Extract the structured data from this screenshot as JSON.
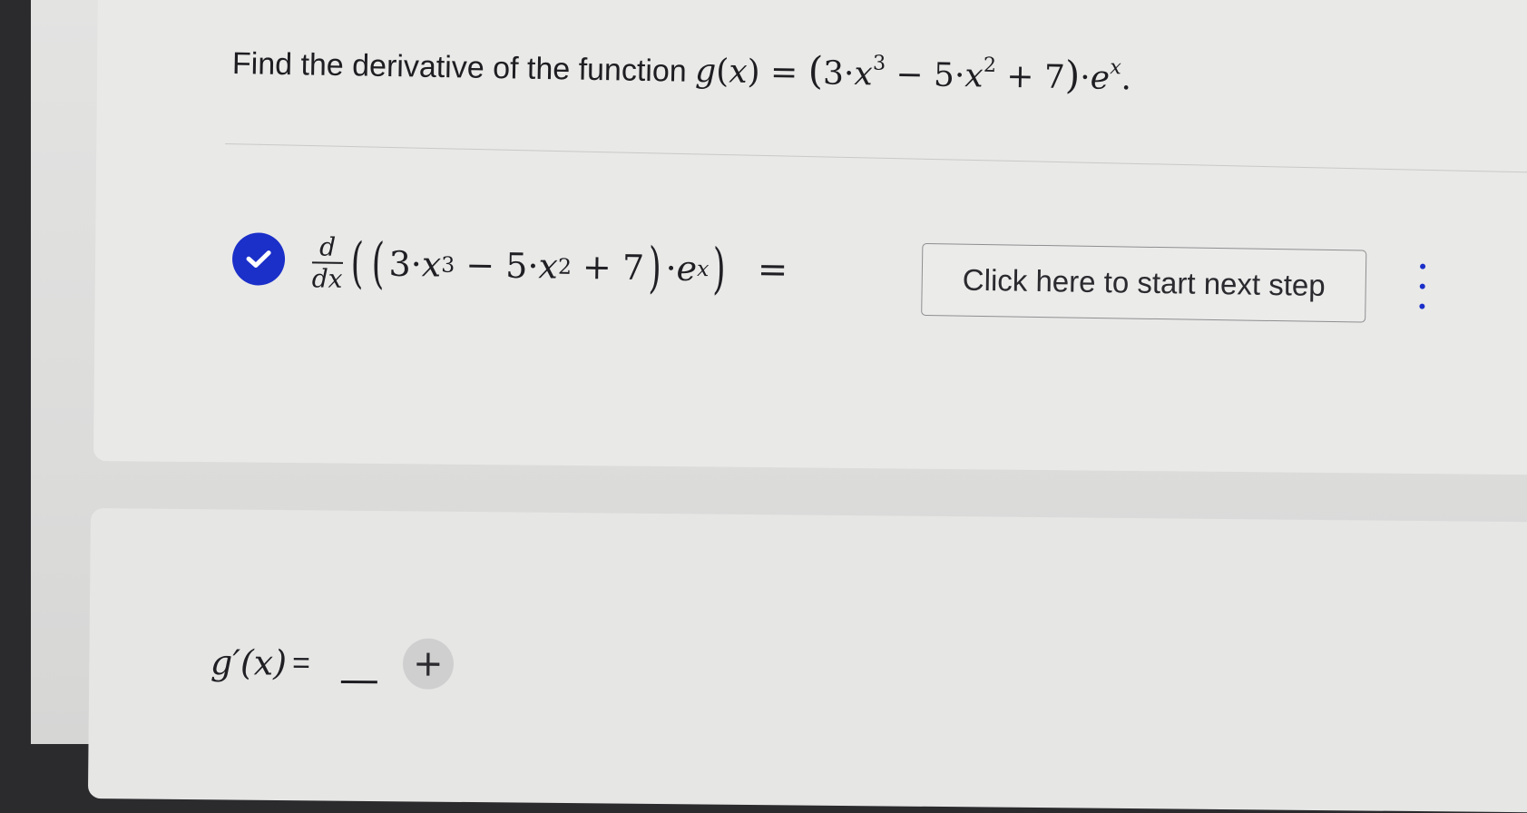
{
  "question": {
    "prompt": "Find the derivative of the function",
    "function_name": "g",
    "variable": "x",
    "expression_parts": {
      "coef_a": "3",
      "exp_a": "3",
      "coef_b": "5",
      "exp_b": "2",
      "constant": "7",
      "base": "e"
    }
  },
  "step": {
    "status_icon": "check-circle-icon",
    "status_color": "#1b2fc9",
    "derivative_num": "d",
    "derivative_den": "dx",
    "equals": "=",
    "next_step_label": "Click here to start next step",
    "menu_icon": "vertical-ellipsis-icon"
  },
  "answer": {
    "label": "g′(x)",
    "equals": "=",
    "add_icon": "plus-icon",
    "add_label": "+"
  }
}
